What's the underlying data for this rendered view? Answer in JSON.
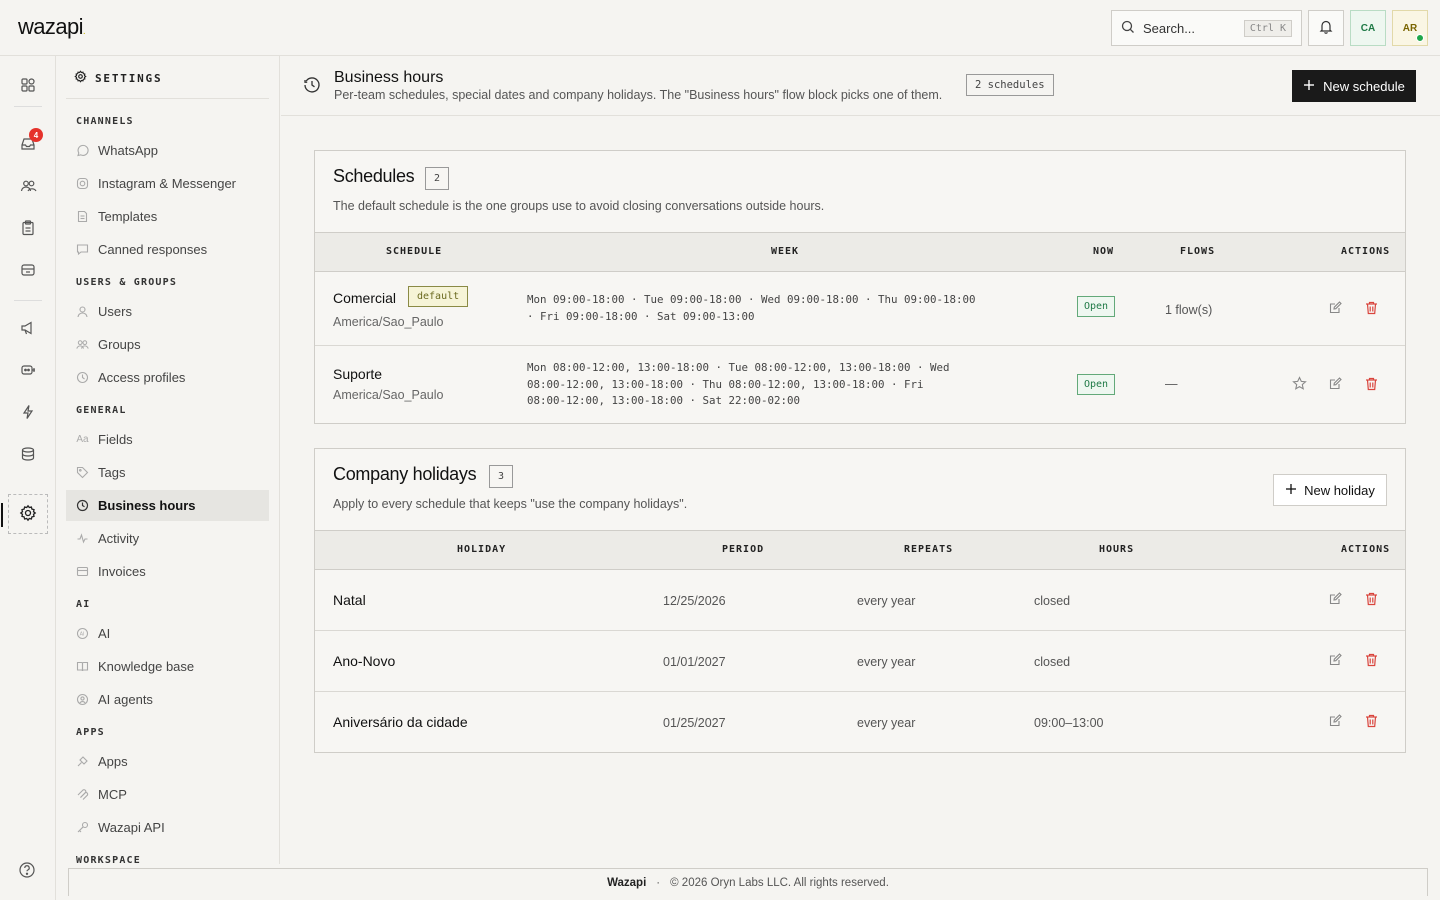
{
  "app": {
    "logo": "wazapi",
    "logo_dot": "."
  },
  "topbar": {
    "search_placeholder": "Search...",
    "search_shortcut": "Ctrl K",
    "avatar_ca": "CA",
    "avatar_ar": "AR"
  },
  "rail": {
    "inbox_badge": "4"
  },
  "nav": {
    "title": "SETTINGS",
    "sections": {
      "channels": "CHANNELS",
      "users_groups": "USERS & GROUPS",
      "general": "GENERAL",
      "ai": "AI",
      "apps": "APPS",
      "workspace": "WORKSPACE"
    },
    "items": {
      "whatsapp": "WhatsApp",
      "instagram": "Instagram & Messenger",
      "templates": "Templates",
      "canned": "Canned responses",
      "users": "Users",
      "groups": "Groups",
      "access": "Access profiles",
      "fields": "Fields",
      "tags": "Tags",
      "business_hours": "Business hours",
      "activity": "Activity",
      "invoices": "Invoices",
      "ai": "AI",
      "knowledge": "Knowledge base",
      "agents": "AI agents",
      "apps": "Apps",
      "mcp": "MCP",
      "api": "Wazapi API"
    }
  },
  "page": {
    "title": "Business hours",
    "subtitle": "Per-team schedules, special dates and company holidays. The \"Business hours\" flow block picks one of them.",
    "chip": "2 schedules",
    "new_schedule": "New schedule"
  },
  "schedules": {
    "title": "Schedules",
    "count": "2",
    "subtitle": "The default schedule is the one groups use to avoid closing conversations outside hours.",
    "headers": {
      "schedule": "SCHEDULE",
      "week": "WEEK",
      "now": "NOW",
      "flows": "FLOWS",
      "actions": "ACTIONS"
    },
    "rows": [
      {
        "name": "Comercial",
        "tag": "default",
        "tz": "America/Sao_Paulo",
        "week": "Mon 09:00-18:00 · Tue 09:00-18:00 · Wed 09:00-18:00 · Thu 09:00-18:00 · Fri 09:00-18:00 · Sat 09:00-13:00",
        "now": "Open",
        "flows": "1 flow(s)"
      },
      {
        "name": "Suporte",
        "tz": "America/Sao_Paulo",
        "week": "Mon 08:00-12:00, 13:00-18:00 · Tue 08:00-12:00, 13:00-18:00 · Wed 08:00-12:00, 13:00-18:00 · Thu 08:00-12:00, 13:00-18:00 · Fri 08:00-12:00, 13:00-18:00 · Sat 22:00-02:00",
        "now": "Open",
        "flows": "—"
      }
    ]
  },
  "holidays": {
    "title": "Company holidays",
    "count": "3",
    "subtitle": "Apply to every schedule that keeps \"use the company holidays\".",
    "new_holiday": "New holiday",
    "headers": {
      "holiday": "HOLIDAY",
      "period": "PERIOD",
      "repeats": "REPEATS",
      "hours": "HOURS",
      "actions": "ACTIONS"
    },
    "rows": [
      {
        "name": "Natal",
        "period": "12/25/2026",
        "repeats": "every year",
        "hours": "closed"
      },
      {
        "name": "Ano-Novo",
        "period": "01/01/2027",
        "repeats": "every year",
        "hours": "closed"
      },
      {
        "name": "Aniversário da cidade",
        "period": "01/25/2027",
        "repeats": "every year",
        "hours": "09:00–13:00"
      }
    ]
  },
  "footer": {
    "brand": "Wazapi",
    "sep": "·",
    "copyright": "© 2026 Oryn Labs LLC. All rights reserved."
  },
  "colors": {
    "accent_dark": "#1a1a1a",
    "open_green": "#1f7a46",
    "delete_red": "#d9443c",
    "default_tag": "#6b6a20"
  }
}
